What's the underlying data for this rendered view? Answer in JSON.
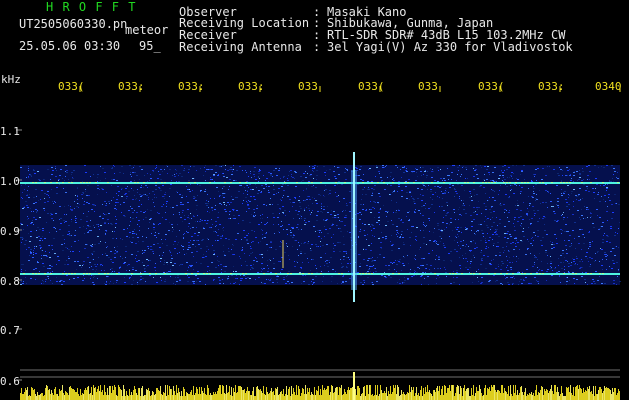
{
  "header": {
    "app_title": "H R O F F T",
    "filename": "UT2505060330.pn",
    "mode": "meteor",
    "datetime": "25.05.06 03:30",
    "count": "95_",
    "fields": [
      {
        "label": "Observer",
        "value": "Masaki Kano"
      },
      {
        "label": "Receiving Location",
        "value": "Shibukawa, Gunma, Japan"
      },
      {
        "label": "Receiver",
        "value": "RTL-SDR SDR# 43dB L15 103.2MHz CW"
      },
      {
        "label": "Receiving Antenna",
        "value": "3el Yagi(V) Az 330 for Vladivostok"
      }
    ]
  },
  "time_axis": {
    "labels": [
      "033(",
      "033:",
      "033:",
      "033:",
      "033",
      "033(",
      "033",
      "033(",
      "033:",
      "0340"
    ]
  },
  "freq_axis": {
    "unit": "kHz",
    "labels": [
      "1.1",
      "1.0",
      "0.9",
      "0.8",
      "0.7",
      "0.6"
    ]
  },
  "colors": {
    "background": "#000000",
    "label_green": "#21d821",
    "text_white": "#e8e8e8",
    "axis_yellow": "#f0e020",
    "noise_blue": "#1a3cff",
    "carrier_cyan": "#4ef2e0"
  }
}
